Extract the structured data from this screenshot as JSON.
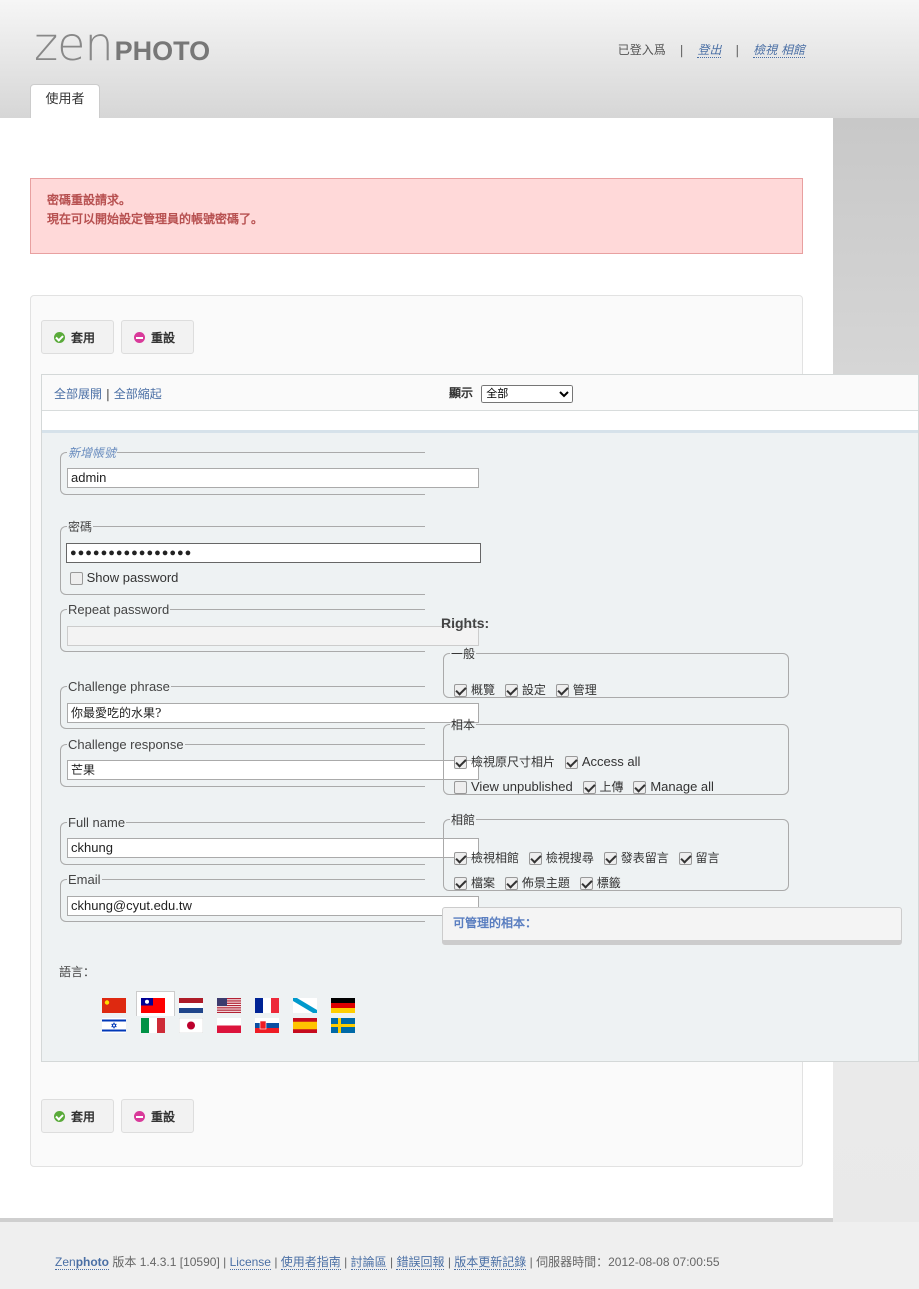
{
  "header": {
    "logo_zen": "zen",
    "logo_photo": "PHOTO",
    "logged_in_as": "已登入爲",
    "logout": "登出",
    "view_gallery": "檢視 相館",
    "sep": "|"
  },
  "tabs": [
    {
      "label": "使用者"
    }
  ],
  "message": {
    "line1": "密碼重設請求。",
    "line2": "現在可以開始設定管理員的帳號密碼了。"
  },
  "buttons": {
    "apply": "套用",
    "reset": "重設"
  },
  "user_list": {
    "expand_all": "全部展開",
    "sep": "|",
    "collapse_all": "全部縮起",
    "show_label": "顯示",
    "show_selected": "全部"
  },
  "form": {
    "new_account_legend": "新增帳號",
    "username": "admin",
    "password_legend": "密碼",
    "password_value": "●●●●●●●●●●●●●●●●",
    "show_password": "Show password",
    "repeat_password_legend": "Repeat password",
    "challenge_phrase_legend": "Challenge phrase",
    "challenge_phrase": "你最愛吃的水果?",
    "challenge_response_legend": "Challenge response",
    "challenge_response": "芒果",
    "full_name_legend": "Full name",
    "full_name": "ckhung",
    "email_legend": "Email",
    "email": "ckhung@cyut.edu.tw",
    "language_label": "語言："
  },
  "rights": {
    "title": "Rights:",
    "general": {
      "legend": "一般",
      "items": [
        "概覽",
        "設定",
        "管理"
      ]
    },
    "album": {
      "legend": "相本",
      "row1": [
        "檢視原尺寸相片",
        "Access all"
      ],
      "row2": [
        "View unpublished",
        "上傳",
        "Manage all"
      ]
    },
    "gallery": {
      "legend": "相館",
      "row1": [
        "檢視相館",
        "檢視搜尋",
        "發表留言",
        "留言"
      ],
      "row2": [
        "檔案",
        "佈景主題",
        "標籤"
      ]
    },
    "managed_albums": "可管理的相本："
  },
  "languages": [
    "zh_CN",
    "zh_TW",
    "nl",
    "en_US",
    "fr",
    "gl",
    "de",
    "he",
    "it",
    "ja",
    "pl",
    "sk",
    "es",
    "sv"
  ],
  "footer": {
    "brand_zen": "Zen",
    "brand_photo": "photo",
    "version_label": "版本",
    "version": "1.4.3.1 [10590]",
    "license": "License",
    "user_guide": "使用者指南",
    "forum": "討論區",
    "bugs": "錯誤回報",
    "changelog": "版本更新記錄",
    "server_time_label": "伺服器時間：",
    "server_time": "2012-08-08 07:00:55",
    "sep": "|"
  },
  "colors": {
    "link": "#4a6fa5",
    "message_bg": "#ffd9d9",
    "message_text": "#b75050",
    "apply_icon": "#5aaa3a",
    "reset_icon": "#d93a9a"
  }
}
